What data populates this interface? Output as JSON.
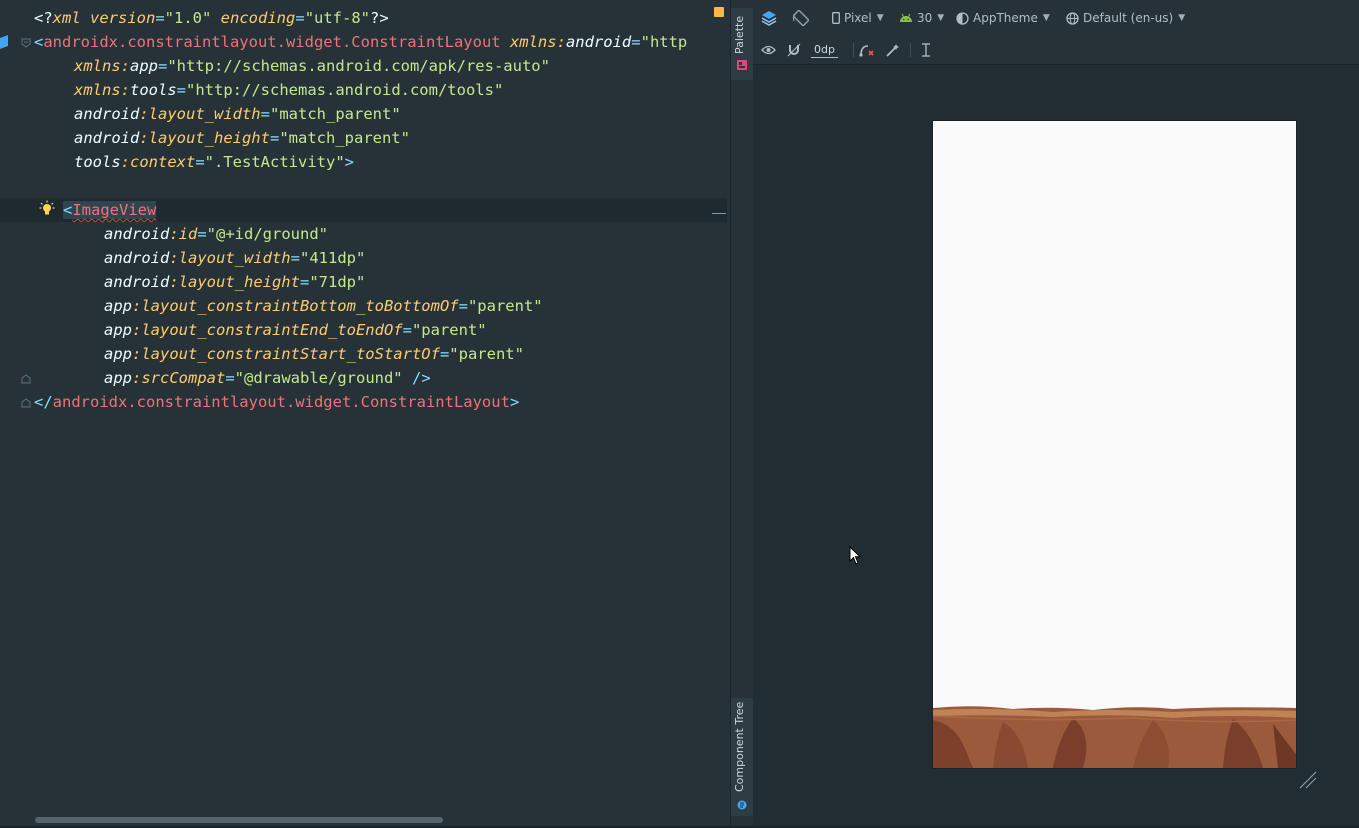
{
  "editor": {
    "lines": {
      "l1": {
        "p1": "<?",
        "ns": "xml",
        "a1": " version",
        "eq1": "=",
        "s1": "\"1.0\"",
        "a2": " encoding",
        "eq2": "=",
        "s2": "\"utf-8\"",
        "p2": "?>"
      },
      "l2": {
        "p1": "<",
        "tag": "androidx.constraintlayout.widget.ConstraintLayout",
        "ns": " xmlns:",
        "attr": "android",
        "eq": "=",
        "str": "\"http"
      },
      "l3": {
        "ns": "xmlns:",
        "attr": "app",
        "eq": "=",
        "str": "\"http://schemas.android.com/apk/res-auto\""
      },
      "l4": {
        "ns": "xmlns:",
        "attr": "tools",
        "eq": "=",
        "str": "\"http://schemas.android.com/tools\""
      },
      "l5": {
        "ns": "android",
        "attr": ":layout_width",
        "eq": "=",
        "str": "\"match_parent\""
      },
      "l6": {
        "ns": "android",
        "attr": ":layout_height",
        "eq": "=",
        "str": "\"match_parent\""
      },
      "l7": {
        "ns": "tools",
        "attr": ":context",
        "eq": "=",
        "str": "\".TestActivity\"",
        "end": ">"
      },
      "l9": {
        "p1": "<",
        "tag": "ImageView"
      },
      "l10": {
        "ns": "android",
        "attr": ":id",
        "eq": "=",
        "str": "\"@+id/ground\""
      },
      "l11": {
        "ns": "android",
        "attr": ":layout_width",
        "eq": "=",
        "str": "\"411dp\""
      },
      "l12": {
        "ns": "android",
        "attr": ":layout_height",
        "eq": "=",
        "str": "\"71dp\""
      },
      "l13": {
        "ns": "app",
        "attr": ":layout_constraintBottom_toBottomOf",
        "eq": "=",
        "str": "\"parent\""
      },
      "l14": {
        "ns": "app",
        "attr": ":layout_constraintEnd_toEndOf",
        "eq": "=",
        "str": "\"parent\""
      },
      "l15": {
        "ns": "app",
        "attr": ":layout_constraintStart_toStartOf",
        "eq": "=",
        "str": "\"parent\""
      },
      "l16": {
        "ns": "app",
        "attr": ":srcCompat",
        "eq": "=",
        "str": "\"@drawable/ground\"",
        "end": " />"
      },
      "l17": {
        "p1": "</",
        "tag": "androidx.constraintlayout.widget.ConstraintLayout",
        "end": ">"
      }
    }
  },
  "side_tabs": {
    "palette": "Palette",
    "component_tree": "Component Tree"
  },
  "toolbar": {
    "device": "Pixel",
    "api_level": "30",
    "theme": "AppTheme",
    "locale": "Default (en-us)",
    "default_margin": "0dp"
  },
  "colors": {
    "editor_bg": "#263238",
    "tag": "#f07178",
    "attribute": "#ffcb6b",
    "string": "#c3e88d",
    "punctuation": "#89ddff",
    "android_green": "#8bc34a",
    "accent_blue": "#42a5f5"
  },
  "icons": [
    "fold-icon",
    "lightbulb-icon",
    "warning-marker-icon",
    "layers-icon",
    "rotate-icon",
    "phone-icon",
    "android-icon",
    "theme-icon",
    "globe-icon",
    "eye-icon",
    "magnet-icon",
    "clear-constraints-icon",
    "infer-constraints-icon",
    "guideline-icon",
    "resize-handle-icon",
    "mouse-cursor-icon"
  ]
}
